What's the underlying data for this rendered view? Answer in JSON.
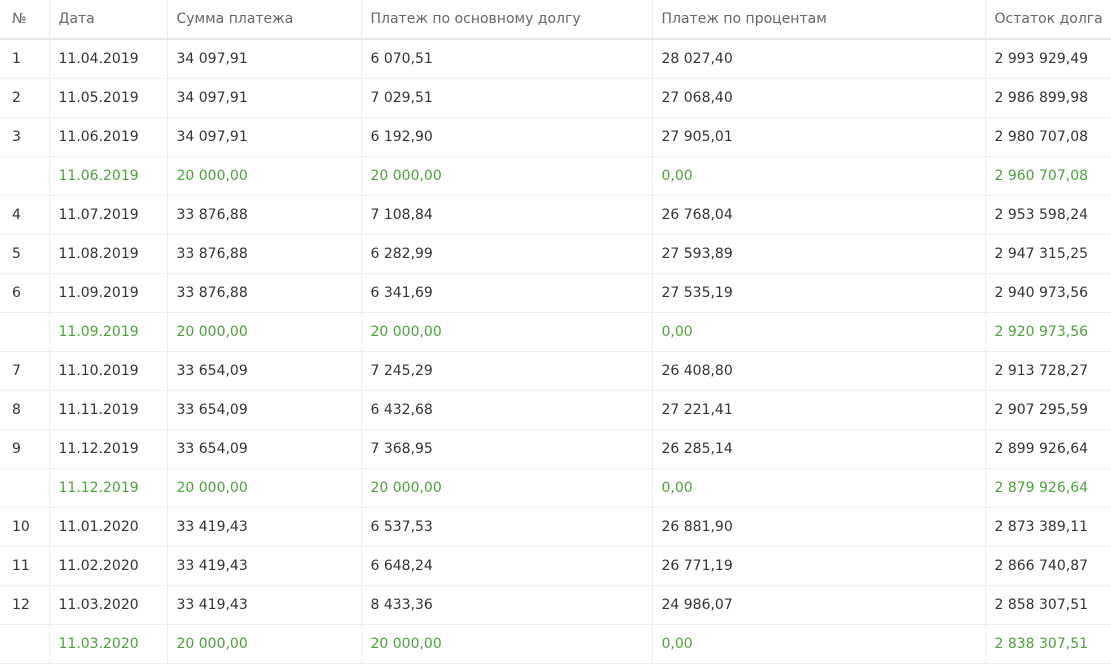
{
  "headers": {
    "num": "№",
    "date": "Дата",
    "sum": "Сумма платежа",
    "principal": "Платеж по основному долгу",
    "interest": "Платеж по процентам",
    "balance": "Остаток долга"
  },
  "rows": [
    {
      "num": "1",
      "date": "11.04.2019",
      "sum": "34 097,91",
      "principal": "6 070,51",
      "interest": "28 027,40",
      "balance": "2 993 929,49",
      "extra": false
    },
    {
      "num": "2",
      "date": "11.05.2019",
      "sum": "34 097,91",
      "principal": "7 029,51",
      "interest": "27 068,40",
      "balance": "2 986 899,98",
      "extra": false
    },
    {
      "num": "3",
      "date": "11.06.2019",
      "sum": "34 097,91",
      "principal": "6 192,90",
      "interest": "27 905,01",
      "balance": "2 980 707,08",
      "extra": false
    },
    {
      "num": "",
      "date": "11.06.2019",
      "sum": "20 000,00",
      "principal": "20 000,00",
      "interest": "0,00",
      "balance": "2 960 707,08",
      "extra": true
    },
    {
      "num": "4",
      "date": "11.07.2019",
      "sum": "33 876,88",
      "principal": "7 108,84",
      "interest": "26 768,04",
      "balance": "2 953 598,24",
      "extra": false
    },
    {
      "num": "5",
      "date": "11.08.2019",
      "sum": "33 876,88",
      "principal": "6 282,99",
      "interest": "27 593,89",
      "balance": "2 947 315,25",
      "extra": false
    },
    {
      "num": "6",
      "date": "11.09.2019",
      "sum": "33 876,88",
      "principal": "6 341,69",
      "interest": "27 535,19",
      "balance": "2 940 973,56",
      "extra": false
    },
    {
      "num": "",
      "date": "11.09.2019",
      "sum": "20 000,00",
      "principal": "20 000,00",
      "interest": "0,00",
      "balance": "2 920 973,56",
      "extra": true
    },
    {
      "num": "7",
      "date": "11.10.2019",
      "sum": "33 654,09",
      "principal": "7 245,29",
      "interest": "26 408,80",
      "balance": "2 913 728,27",
      "extra": false
    },
    {
      "num": "8",
      "date": "11.11.2019",
      "sum": "33 654,09",
      "principal": "6 432,68",
      "interest": "27 221,41",
      "balance": "2 907 295,59",
      "extra": false
    },
    {
      "num": "9",
      "date": "11.12.2019",
      "sum": "33 654,09",
      "principal": "7 368,95",
      "interest": "26 285,14",
      "balance": "2 899 926,64",
      "extra": false
    },
    {
      "num": "",
      "date": "11.12.2019",
      "sum": "20 000,00",
      "principal": "20 000,00",
      "interest": "0,00",
      "balance": "2 879 926,64",
      "extra": true
    },
    {
      "num": "10",
      "date": "11.01.2020",
      "sum": "33 419,43",
      "principal": "6 537,53",
      "interest": "26 881,90",
      "balance": "2 873 389,11",
      "extra": false
    },
    {
      "num": "11",
      "date": "11.02.2020",
      "sum": "33 419,43",
      "principal": "6 648,24",
      "interest": "26 771,19",
      "balance": "2 866 740,87",
      "extra": false
    },
    {
      "num": "12",
      "date": "11.03.2020",
      "sum": "33 419,43",
      "principal": "8 433,36",
      "interest": "24 986,07",
      "balance": "2 858 307,51",
      "extra": false
    },
    {
      "num": "",
      "date": "11.03.2020",
      "sum": "20 000,00",
      "principal": "20 000,00",
      "interest": "0,00",
      "balance": "2 838 307,51",
      "extra": true
    }
  ],
  "colors": {
    "extra_payment_text": "#4aa33a",
    "text": "#333333",
    "header_text": "#666666",
    "grid": "#eceeed"
  }
}
